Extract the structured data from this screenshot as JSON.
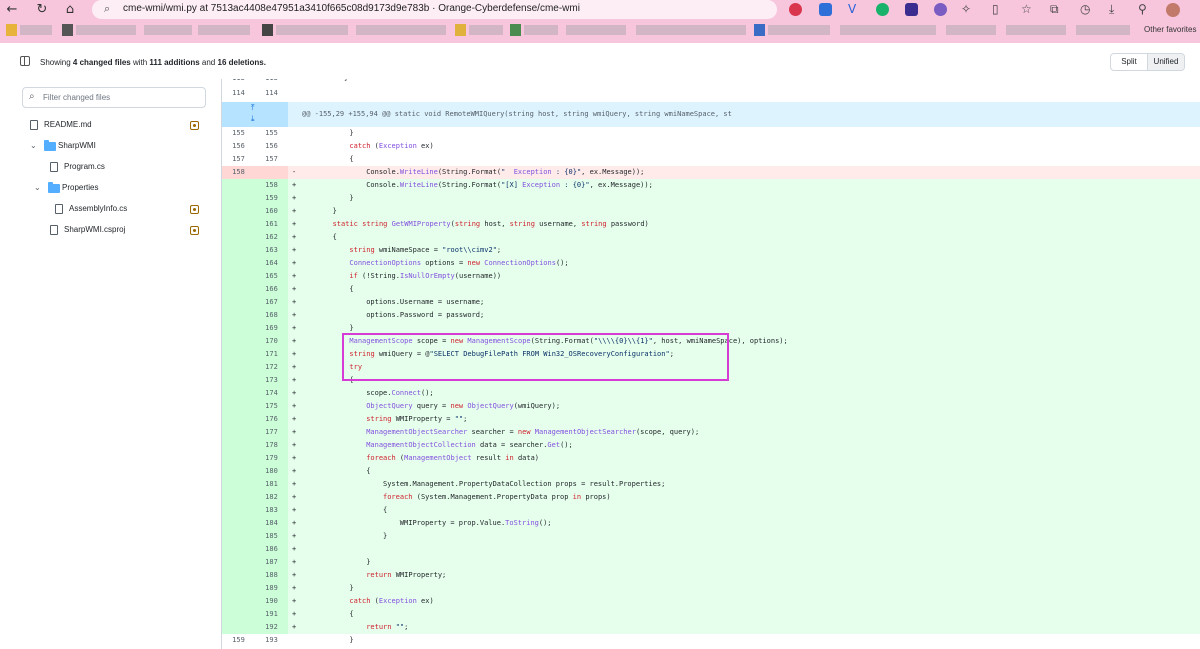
{
  "browser": {
    "url": "cme-wmi/wmi.py at 7513ac4408e47951a3410f665c08d9173d9e783b · Orange-Cyberdefense/cme-wmi",
    "bookmarks": {
      "other_favorites": "Other favorites"
    },
    "colors": {
      "frame": "#f7c6dc"
    }
  },
  "diff_toolbar": {
    "summary_prefix": "Showing",
    "files_changed": "4 changed files",
    "summary_mid": "with",
    "additions": "111 additions",
    "summary_and": "and",
    "deletions": "16 deletions.",
    "split_label": "Split",
    "unified_label": "Unified"
  },
  "sidebar": {
    "filter_placeholder": "Filter changed files",
    "items": [
      {
        "label": "README.md",
        "kind": "file",
        "modified": true
      },
      {
        "label": "SharpWMI",
        "kind": "folder"
      },
      {
        "label": "Program.cs",
        "kind": "file",
        "modified": false
      },
      {
        "label": "Properties",
        "kind": "folder"
      },
      {
        "label": "AssemblyInfo.cs",
        "kind": "file",
        "modified": true
      },
      {
        "label": "SharpWMI.csproj",
        "kind": "file",
        "modified": true
      }
    ]
  },
  "diff": {
    "top_rows": [
      {
        "old": "113",
        "new": "113",
        "code": "}"
      },
      {
        "old": "114",
        "new": "114",
        "code": ""
      }
    ],
    "hunk_header": "@@ -155,29 +155,94 @@ static void RemoteWMIQuery(string host, string wmiQuery, string wmiNameSpace, st",
    "lines": [
      {
        "type": "ctx",
        "old": "155",
        "new": "155",
        "indent": 3,
        "code": "}"
      },
      {
        "type": "ctx",
        "old": "156",
        "new": "156",
        "indent": 3,
        "code": "catch (Exception ex)"
      },
      {
        "type": "ctx",
        "old": "157",
        "new": "157",
        "indent": 3,
        "code": "{"
      },
      {
        "type": "del",
        "old": "158",
        "new": "",
        "indent": 4,
        "code": "Console.WriteLine(String.Format(\"  Exception : {0}\", ex.Message));"
      },
      {
        "type": "add",
        "old": "",
        "new": "158",
        "indent": 4,
        "code": "Console.WriteLine(String.Format(\"[X] Exception : {0}\", ex.Message));"
      },
      {
        "type": "add",
        "old": "",
        "new": "159",
        "indent": 3,
        "code": "}"
      },
      {
        "type": "add",
        "old": "",
        "new": "160",
        "indent": 2,
        "code": "}"
      },
      {
        "type": "add",
        "old": "",
        "new": "161",
        "indent": 2,
        "code": "static string GetWMIProperty(string host, string username, string password)"
      },
      {
        "type": "add",
        "old": "",
        "new": "162",
        "indent": 2,
        "code": "{"
      },
      {
        "type": "add",
        "old": "",
        "new": "163",
        "indent": 3,
        "code": "string wmiNameSpace = \"root\\\\cimv2\";"
      },
      {
        "type": "add",
        "old": "",
        "new": "164",
        "indent": 3,
        "code": "ConnectionOptions options = new ConnectionOptions();"
      },
      {
        "type": "add",
        "old": "",
        "new": "165",
        "indent": 3,
        "code": "if (!String.IsNullOrEmpty(username))"
      },
      {
        "type": "add",
        "old": "",
        "new": "166",
        "indent": 3,
        "code": "{"
      },
      {
        "type": "add",
        "old": "",
        "new": "167",
        "indent": 4,
        "code": "options.Username = username;"
      },
      {
        "type": "add",
        "old": "",
        "new": "168",
        "indent": 4,
        "code": "options.Password = password;"
      },
      {
        "type": "add",
        "old": "",
        "new": "169",
        "indent": 3,
        "code": "}"
      },
      {
        "type": "add",
        "old": "",
        "new": "170",
        "indent": 3,
        "code": "ManagementScope scope = new ManagementScope(String.Format(\"\\\\\\\\{0}\\\\{1}\", host, wmiNameSpace), options);"
      },
      {
        "type": "add",
        "old": "",
        "new": "171",
        "indent": 3,
        "code": "string wmiQuery = @\"SELECT DebugFilePath FROM Win32_OSRecoveryConfiguration\";"
      },
      {
        "type": "add",
        "old": "",
        "new": "172",
        "indent": 3,
        "code": "try"
      },
      {
        "type": "add",
        "old": "",
        "new": "173",
        "indent": 3,
        "code": "{"
      },
      {
        "type": "add",
        "old": "",
        "new": "174",
        "indent": 4,
        "code": "scope.Connect();"
      },
      {
        "type": "add",
        "old": "",
        "new": "175",
        "indent": 4,
        "code": "ObjectQuery query = new ObjectQuery(wmiQuery);"
      },
      {
        "type": "add",
        "old": "",
        "new": "176",
        "indent": 4,
        "code": "string WMIProperty = \"\";"
      },
      {
        "type": "add",
        "old": "",
        "new": "177",
        "indent": 4,
        "code": "ManagementObjectSearcher searcher = new ManagementObjectSearcher(scope, query);"
      },
      {
        "type": "add",
        "old": "",
        "new": "178",
        "indent": 4,
        "code": "ManagementObjectCollection data = searcher.Get();"
      },
      {
        "type": "add",
        "old": "",
        "new": "179",
        "indent": 4,
        "code": "foreach (ManagementObject result in data)"
      },
      {
        "type": "add",
        "old": "",
        "new": "180",
        "indent": 4,
        "code": "{"
      },
      {
        "type": "add",
        "old": "",
        "new": "181",
        "indent": 5,
        "code": "System.Management.PropertyDataCollection props = result.Properties;"
      },
      {
        "type": "add",
        "old": "",
        "new": "182",
        "indent": 5,
        "code": "foreach (System.Management.PropertyData prop in props)"
      },
      {
        "type": "add",
        "old": "",
        "new": "183",
        "indent": 5,
        "code": "{"
      },
      {
        "type": "add",
        "old": "",
        "new": "184",
        "indent": 6,
        "code": "WMIProperty = prop.Value.ToString();"
      },
      {
        "type": "add",
        "old": "",
        "new": "185",
        "indent": 5,
        "code": "}"
      },
      {
        "type": "add",
        "old": "",
        "new": "186",
        "indent": 0,
        "code": ""
      },
      {
        "type": "add",
        "old": "",
        "new": "187",
        "indent": 4,
        "code": "}"
      },
      {
        "type": "add",
        "old": "",
        "new": "188",
        "indent": 4,
        "code": "return WMIProperty;"
      },
      {
        "type": "add",
        "old": "",
        "new": "189",
        "indent": 3,
        "code": "}"
      },
      {
        "type": "add",
        "old": "",
        "new": "190",
        "indent": 3,
        "code": "catch (Exception ex)"
      },
      {
        "type": "add",
        "old": "",
        "new": "191",
        "indent": 3,
        "code": "{"
      },
      {
        "type": "add",
        "old": "",
        "new": "192",
        "indent": 4,
        "code": "return \"\";"
      },
      {
        "type": "ctx",
        "old": "159",
        "new": "193",
        "indent": 3,
        "code": "}"
      }
    ],
    "colors": {
      "add_bg": "#e6ffec",
      "add_gutter": "#ccffd8",
      "del_bg": "#ffebe9",
      "del_gutter": "#ffd7d5",
      "highlight": "#d63bd6"
    }
  }
}
